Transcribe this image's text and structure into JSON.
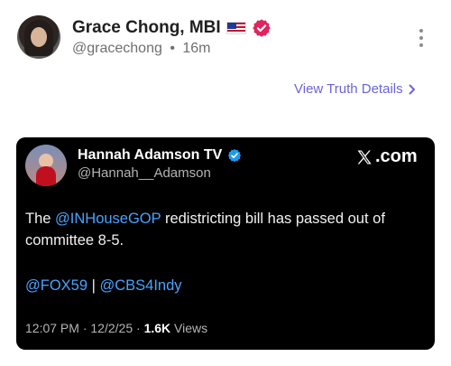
{
  "post": {
    "author_name": "Grace Chong, MBI",
    "handle": "@gracechong",
    "separator": "•",
    "time_ago": "16m",
    "view_details_label": "View Truth Details"
  },
  "embed": {
    "author_name": "Hannah Adamson TV",
    "handle": "@Hannah__Adamson",
    "source_label": ".com",
    "text_prefix": "The ",
    "mention": "@INHouseGOP",
    "text_suffix": " redistricting bill has passed out of committee 8-5.",
    "link_1": "@FOX59",
    "link_separator": " | ",
    "link_2": "@CBS4Indy",
    "time": "12:07 PM",
    "meta_sep": " · ",
    "date": "12/2/25",
    "views_count": "1.6K",
    "views_label": " Views"
  },
  "colors": {
    "accent": "#6c63d9",
    "verified_badge": "#e0245e",
    "x_verified": "#1d9bf0",
    "mention": "#4aa3ff"
  },
  "icons": [
    "flag-us-icon",
    "verified-badge-icon",
    "more-vertical-icon",
    "chevron-right-icon",
    "x-logo-icon"
  ]
}
